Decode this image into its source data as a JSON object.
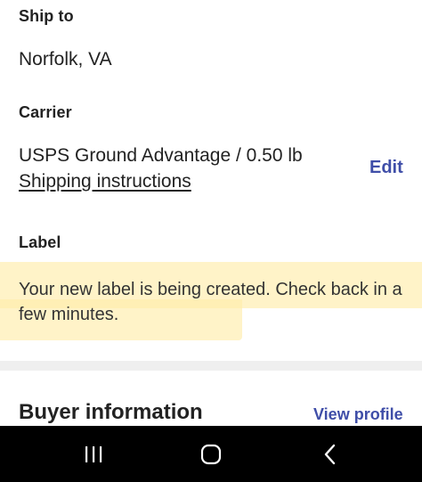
{
  "ship_to": {
    "heading": "Ship to",
    "location": "Norfolk, VA"
  },
  "carrier": {
    "heading": "Carrier",
    "service": "USPS Ground Advantage / 0.50 lb",
    "instructions_link": "Shipping instructions",
    "edit_label": "Edit"
  },
  "label_section": {
    "heading": "Label",
    "message": "Your new label is being created.  Check back in a few minutes.",
    "highlight_color": "#FFECAA"
  },
  "buyer": {
    "heading": "Buyer information",
    "view_profile_label": "View profile"
  },
  "system_nav": {
    "icons": [
      "recents-icon",
      "home-icon",
      "back-icon"
    ]
  },
  "colors": {
    "link": "#3F4EA8",
    "divider": "#EFEFEF",
    "nav_bar": "#000000"
  }
}
